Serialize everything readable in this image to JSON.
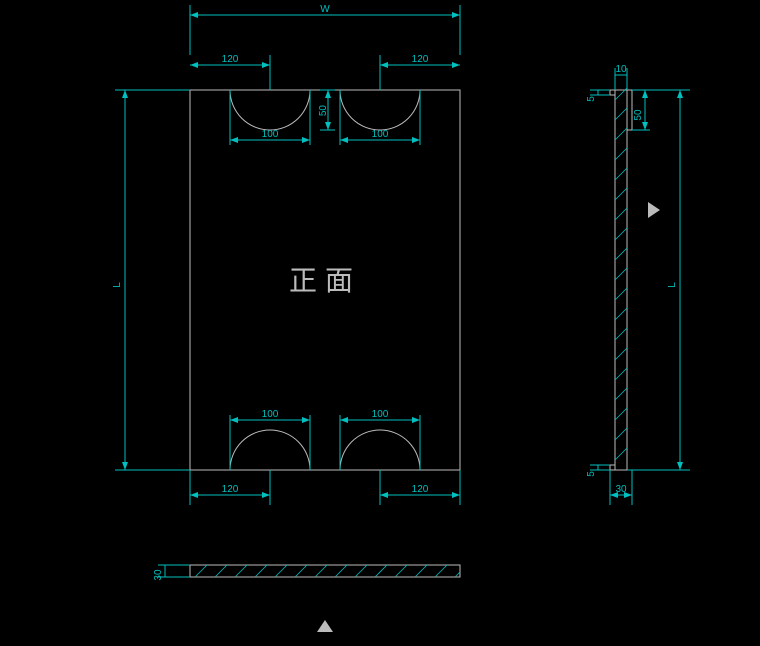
{
  "title": "正面",
  "dimensions": {
    "W_label": "W",
    "L_label": "L",
    "L_label2": "L",
    "top_left_120": "120",
    "top_right_120": "120",
    "bottom_left_120": "120",
    "bottom_right_120": "120",
    "left_arc_100_top": "100",
    "right_arc_100_top": "100",
    "left_arc_100_bottom": "100",
    "right_arc_100_bottom": "100",
    "depth_50": "50",
    "side_10": "10",
    "side_5_top": "5",
    "side_5_bottom": "5",
    "side_50": "50",
    "side_30": "30",
    "bottom_30": "30"
  },
  "diagram_type": "CAD technical drawing",
  "views": [
    "front",
    "side",
    "bottom"
  ]
}
